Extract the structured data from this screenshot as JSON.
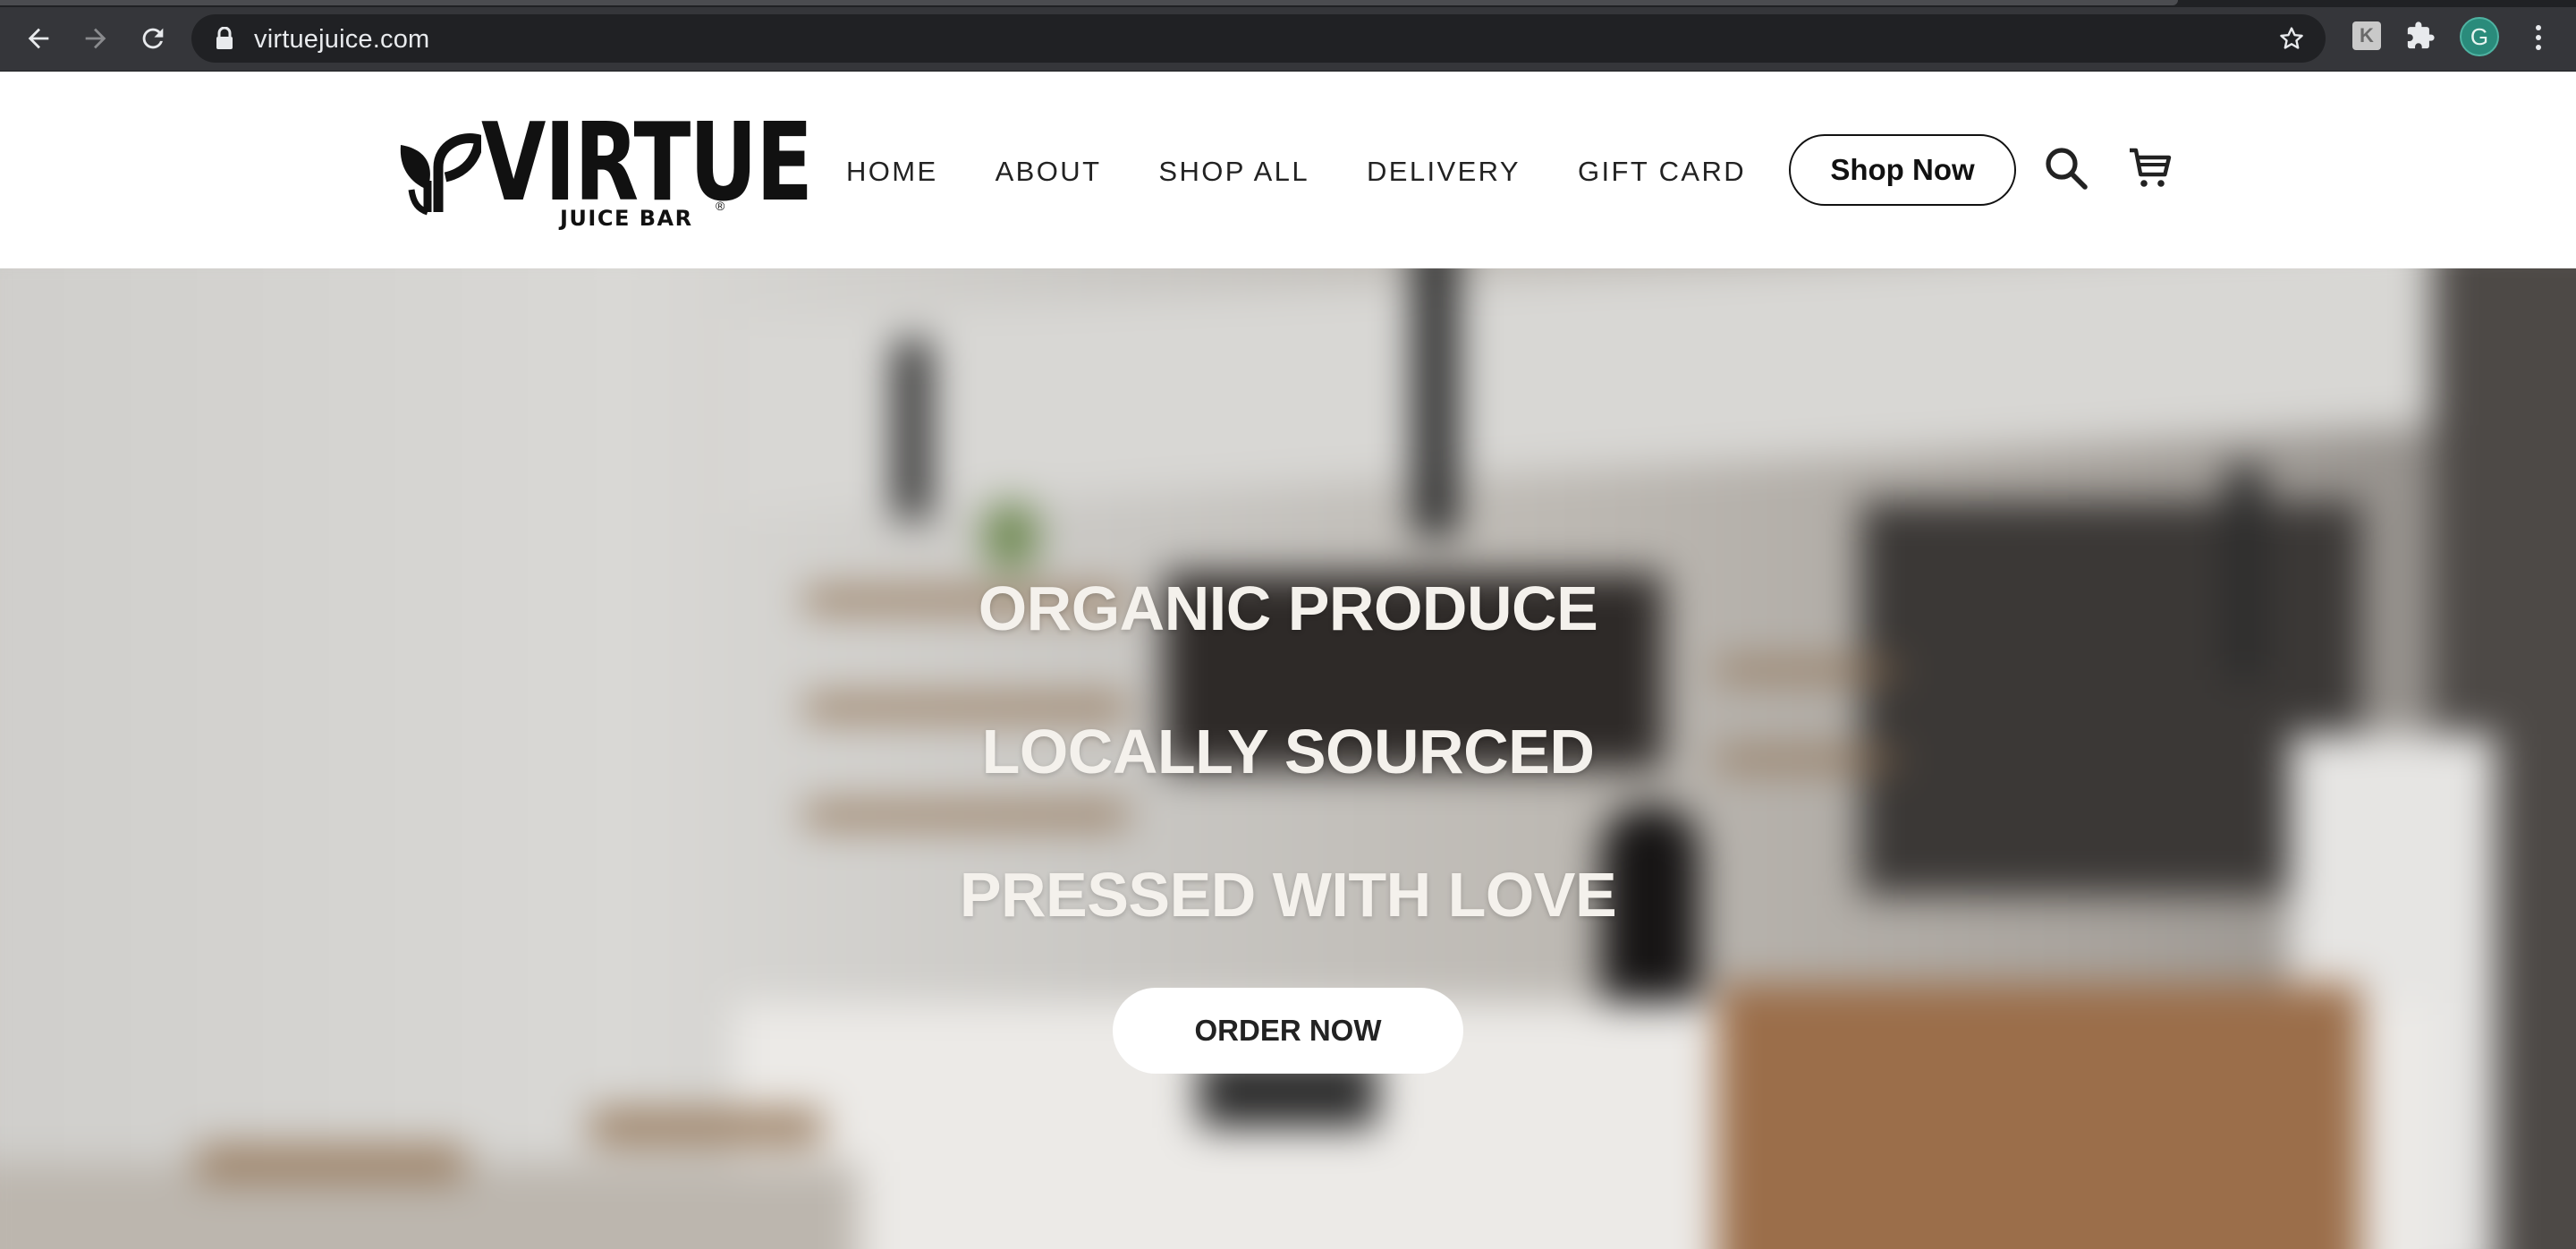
{
  "browser": {
    "url": "virtuejuice.com",
    "profile_initial": "G",
    "extension_letter": "K",
    "icons": [
      "back-arrow-icon",
      "forward-arrow-icon",
      "reload-icon",
      "lock-icon",
      "star-icon",
      "puzzle-icon",
      "kebab-menu-icon"
    ]
  },
  "header": {
    "logo_word": "VIRTUE",
    "logo_sub": "JUICE BAR",
    "logo_registered": "®",
    "nav": [
      "HOME",
      "ABOUT",
      "SHOP ALL",
      "DELIVERY",
      "GIFT CARD"
    ],
    "shop_button": "Shop Now",
    "icons": [
      "search-icon",
      "cart-icon"
    ]
  },
  "hero": {
    "lines": [
      "ORGANIC PRODUCE",
      "LOCALLY SOURCED",
      "PRESSED WITH LOVE"
    ],
    "cta": "ORDER NOW"
  },
  "colors": {
    "chrome_bg": "#35363a",
    "omnibox_bg": "#202124",
    "avatar_bg": "#2a8b7b",
    "header_bg": "#ffffff",
    "text_dark": "#111111",
    "hero_text": "#f4f1ec"
  }
}
